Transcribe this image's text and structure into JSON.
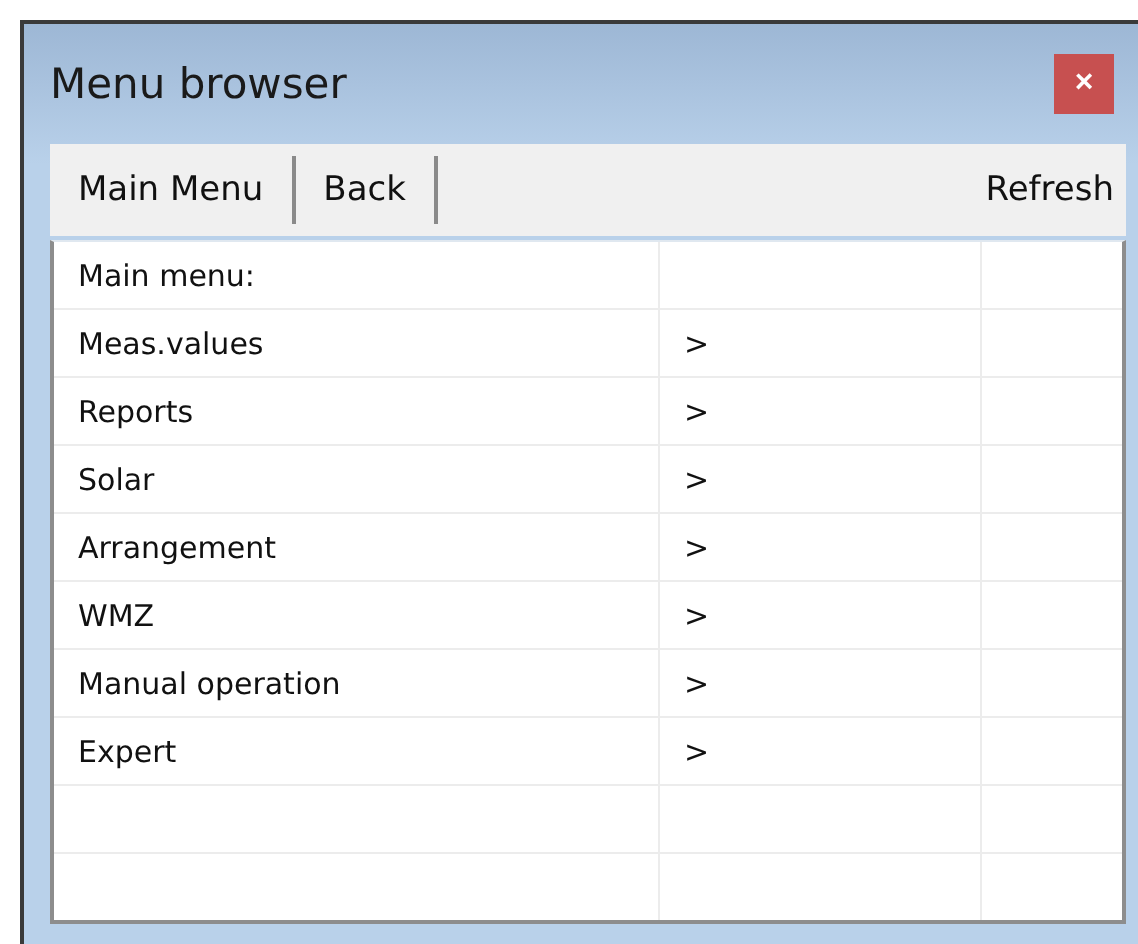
{
  "window": {
    "title": "Menu browser",
    "close": "×"
  },
  "toolbar": {
    "left": [
      "Main Menu",
      "Back"
    ],
    "right": "Refresh"
  },
  "menu": {
    "heading": "Main menu:",
    "items": [
      {
        "label": "Meas.values",
        "arrow": ">"
      },
      {
        "label": "Reports",
        "arrow": ">"
      },
      {
        "label": "Solar",
        "arrow": ">"
      },
      {
        "label": "Arrangement",
        "arrow": ">"
      },
      {
        "label": "WMZ",
        "arrow": ">"
      },
      {
        "label": "Manual operation",
        "arrow": ">"
      },
      {
        "label": "Expert",
        "arrow": ">"
      }
    ]
  }
}
